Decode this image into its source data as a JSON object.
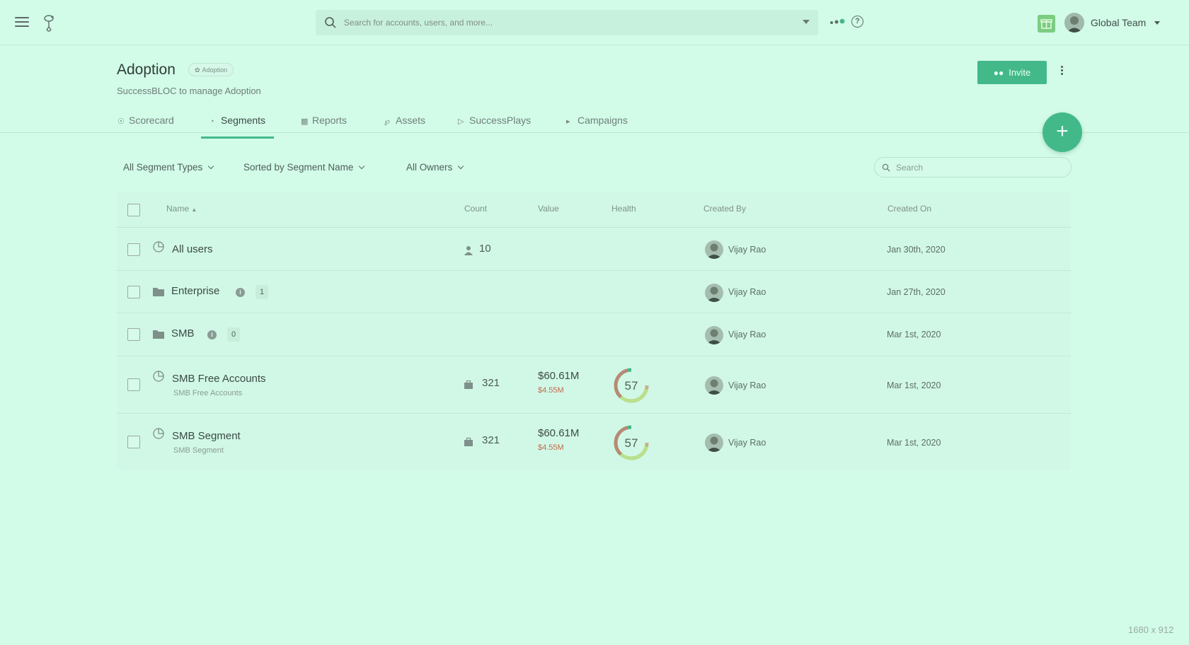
{
  "topbar": {
    "search_placeholder": "Search for accounts, users, and more...",
    "team_name": "Global Team"
  },
  "header": {
    "title": "Adoption",
    "tag": "Adoption",
    "subtitle": "SuccessBLOC to manage Adoption",
    "invite_label": "Invite"
  },
  "tabs": [
    {
      "label": "Scorecard",
      "icon": "gauge-icon"
    },
    {
      "label": "Segments",
      "icon": "pie-icon",
      "active": true
    },
    {
      "label": "Reports",
      "icon": "bar-chart-icon"
    },
    {
      "label": "Assets",
      "icon": "paperclip-icon"
    },
    {
      "label": "SuccessPlays",
      "icon": "play-icon"
    },
    {
      "label": "Campaigns",
      "icon": "megaphone-icon"
    }
  ],
  "filters": {
    "segment_types": "All Segment Types",
    "sort": "Sorted by Segment Name",
    "owners": "All Owners",
    "search_placeholder": "Search"
  },
  "table": {
    "columns": {
      "name": "Name",
      "count": "Count",
      "value": "Value",
      "health": "Health",
      "created_by": "Created By",
      "created_on": "Created On"
    },
    "rows": [
      {
        "name": "All users",
        "type": "segment",
        "count_icon": "user-icon",
        "count": "10",
        "created_by": "Vijay Rao",
        "created_on": "Jan 30th, 2020"
      },
      {
        "name": "Enterprise",
        "type": "folder",
        "badge": "1",
        "created_by": "Vijay Rao",
        "created_on": "Jan 27th, 2020"
      },
      {
        "name": "SMB",
        "type": "folder",
        "badge": "0",
        "created_by": "Vijay Rao",
        "created_on": "Mar 1st, 2020"
      },
      {
        "name": "SMB Free Accounts",
        "sub": "SMB Free Accounts",
        "type": "segment",
        "count_icon": "briefcase-icon",
        "count": "321",
        "value": "$60.61M",
        "value_sub": "$4.55M",
        "health": "57",
        "created_by": "Vijay Rao",
        "created_on": "Mar 1st, 2020"
      },
      {
        "name": "SMB Segment",
        "sub": "SMB Segment",
        "type": "segment",
        "count_icon": "briefcase-icon",
        "count": "321",
        "value": "$60.61M",
        "value_sub": "$4.55M",
        "health": "57",
        "created_by": "Vijay Rao",
        "created_on": "Mar 1st, 2020"
      }
    ]
  },
  "colors": {
    "accent": "#43b98a",
    "background": "#d2fbe8",
    "value_sub": "#c46a4c"
  },
  "footer_label": "1680 x 912"
}
